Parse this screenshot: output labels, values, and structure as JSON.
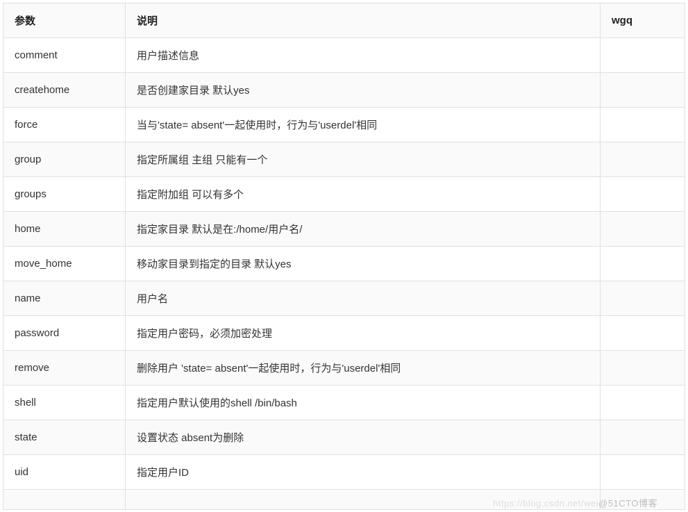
{
  "headers": {
    "param": "参数",
    "desc": "说明",
    "wgq": "wgq"
  },
  "rows": [
    {
      "param": "comment",
      "desc": "用户描述信息",
      "wgq": ""
    },
    {
      "param": "createhome",
      "desc": "是否创建家目录  默认yes",
      "wgq": ""
    },
    {
      "param": "force",
      "desc": "当与'state= absent'一起使用时，行为与'userdel'相同",
      "wgq": ""
    },
    {
      "param": "group",
      "desc": "指定所属组  主组 只能有一个",
      "wgq": ""
    },
    {
      "param": "groups",
      "desc": "指定附加组  可以有多个",
      "wgq": ""
    },
    {
      "param": "home",
      "desc": "指定家目录   默认是在:/home/用户名/",
      "wgq": ""
    },
    {
      "param": "move_home",
      "desc": "移动家目录到指定的目录 默认yes",
      "wgq": ""
    },
    {
      "param": "name",
      "desc": "用户名",
      "wgq": ""
    },
    {
      "param": "password",
      "desc": "指定用户密码，必须加密处理",
      "wgq": ""
    },
    {
      "param": "remove",
      "desc": "删除用户 'state= absent'一起使用时，行为与'userdel'相同",
      "wgq": ""
    },
    {
      "param": "shell",
      "desc": "指定用户默认使用的shell    /bin/bash",
      "wgq": ""
    },
    {
      "param": "state",
      "desc": "设置状态    absent为删除",
      "wgq": ""
    },
    {
      "param": "uid",
      "desc": "指定用户ID",
      "wgq": ""
    },
    {
      "param": "",
      "desc": "",
      "wgq": ""
    }
  ],
  "watermark": {
    "left": "https://blog.csdn.net/wei",
    "right": "@51CTO博客"
  }
}
